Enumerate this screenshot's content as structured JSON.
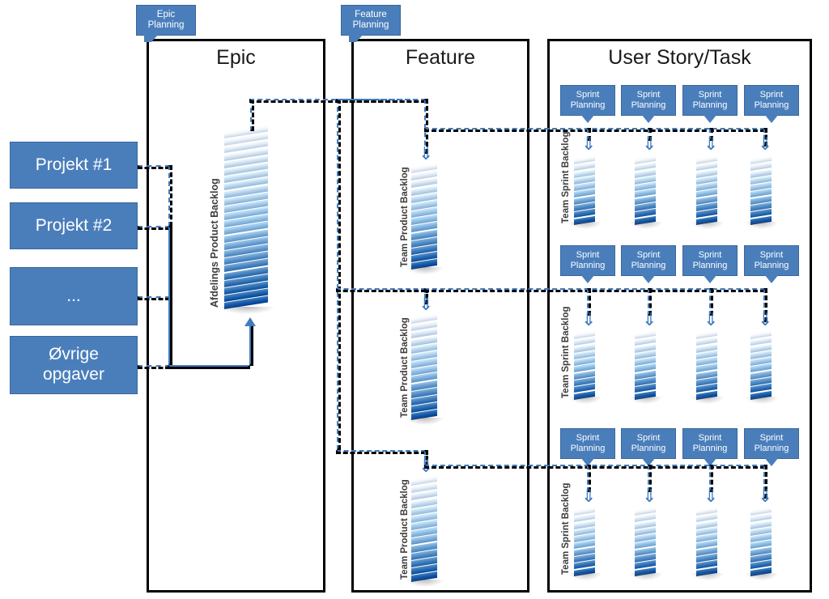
{
  "diagram": {
    "title_epic": "Epic",
    "title_feature": "Feature",
    "title_userstory": "User Story/Task"
  },
  "left_boxes": [
    {
      "label": "Projekt #1"
    },
    {
      "label": "Projekt #2"
    },
    {
      "label": "..."
    },
    {
      "label": "Øvrige\nopgaver"
    }
  ],
  "callouts": {
    "epic_planning": "Epic\nPlanning",
    "feature_planning": "Feature\nPlanning",
    "sprint_planning": "Sprint\nPlanning"
  },
  "labels": {
    "afdelings_product_backlog": "Afdelings Product Backlog",
    "team_product_backlog": "Team Product Backlog",
    "team_sprint_backlog": "Team Sprint Backlog"
  },
  "epic_column": {
    "stack_label": "Afdelings Product Backlog"
  },
  "feature_column": {
    "teams": [
      {
        "stack_label": "Team Product Backlog"
      },
      {
        "stack_label": "Team Product Backlog"
      },
      {
        "stack_label": "Team Product Backlog"
      }
    ]
  },
  "userstory_column": {
    "rows": [
      {
        "stack_label": "Team Sprint Backlog",
        "cards": [
          {
            "label": "Sprint\nPlanning"
          },
          {
            "label": "Sprint\nPlanning"
          },
          {
            "label": "Sprint\nPlanning"
          },
          {
            "label": "Sprint\nPlanning"
          }
        ]
      },
      {
        "stack_label": "Team Sprint Backlog",
        "cards": [
          {
            "label": "Sprint\nPlanning"
          },
          {
            "label": "Sprint\nPlanning"
          },
          {
            "label": "Sprint\nPlanning"
          },
          {
            "label": "Sprint\nPlanning"
          }
        ]
      },
      {
        "stack_label": "Team Sprint Backlog",
        "cards": [
          {
            "label": "Sprint\nPlanning"
          },
          {
            "label": "Sprint\nPlanning"
          },
          {
            "label": "Sprint\nPlanning"
          },
          {
            "label": "Sprint\nPlanning"
          }
        ]
      }
    ]
  },
  "colors": {
    "box_fill": "#4a7ebb",
    "box_border": "#3a6699",
    "connector": "#3f7cc0",
    "panel_border": "#000000",
    "text_on_blue": "#ffffff",
    "title_text": "#1a1a1a",
    "vertical_label": "#3d3d3d"
  }
}
